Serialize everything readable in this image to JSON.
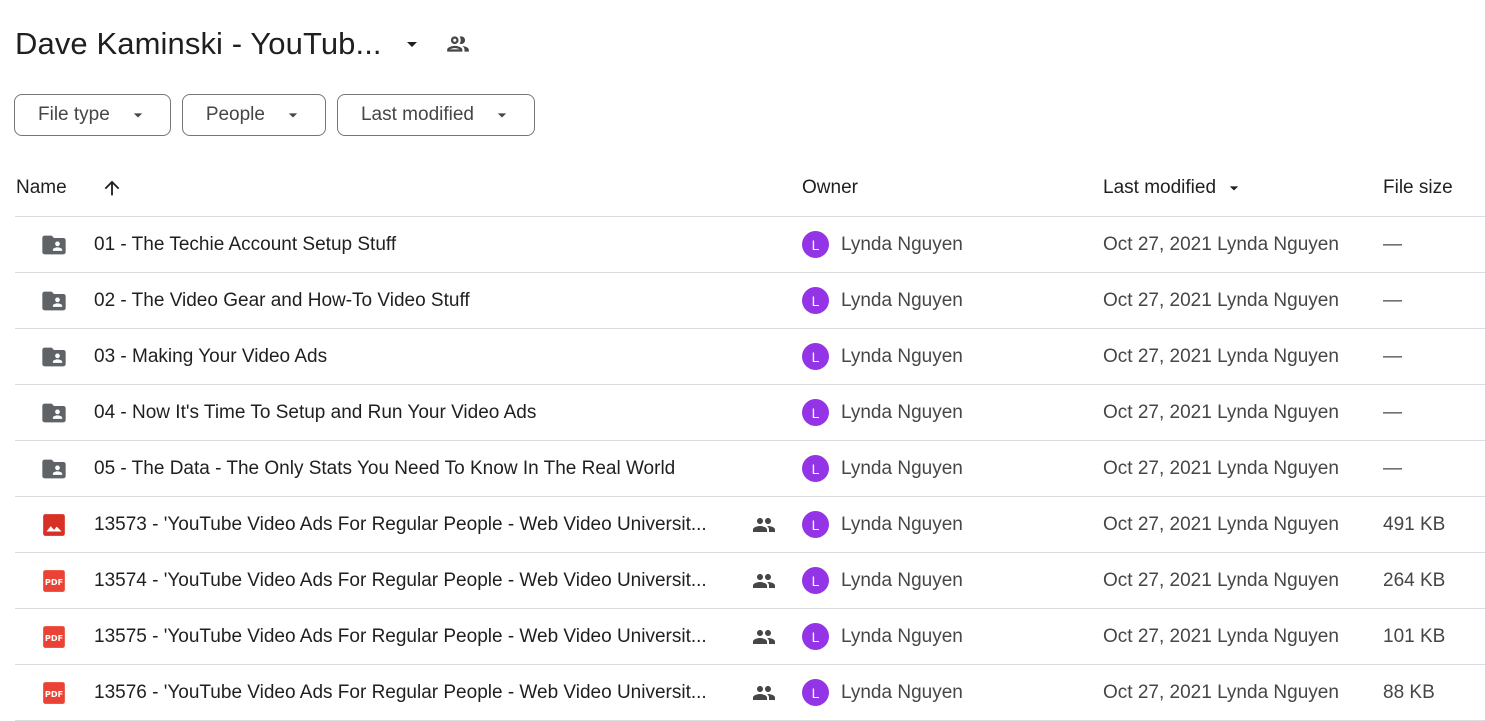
{
  "header": {
    "title": "Dave Kaminski - YouTub...",
    "caret_icon": "arrow-drop-down-icon",
    "shared_icon": "people-icon"
  },
  "filters": [
    {
      "label": "File type"
    },
    {
      "label": "People"
    },
    {
      "label": "Last modified"
    }
  ],
  "columns": {
    "name": "Name",
    "owner": "Owner",
    "last_modified": "Last modified",
    "file_size": "File size"
  },
  "colors": {
    "folder": "#5f6368",
    "image": "#d93025",
    "pdf": "#ea4335",
    "avatar": "#9334e6"
  },
  "rows": [
    {
      "type": "shared-folder",
      "name": "01 - The Techie Account Setup Stuff",
      "shared": false,
      "owner_initial": "L",
      "owner": "Lynda Nguyen",
      "modified": "Oct 27, 2021 Lynda Nguyen",
      "size": "—"
    },
    {
      "type": "shared-folder",
      "name": "02 - The Video Gear and How-To Video Stuff",
      "shared": false,
      "owner_initial": "L",
      "owner": "Lynda Nguyen",
      "modified": "Oct 27, 2021 Lynda Nguyen",
      "size": "—"
    },
    {
      "type": "shared-folder",
      "name": "03 - Making Your Video Ads",
      "shared": false,
      "owner_initial": "L",
      "owner": "Lynda Nguyen",
      "modified": "Oct 27, 2021 Lynda Nguyen",
      "size": "—"
    },
    {
      "type": "shared-folder",
      "name": "04 - Now It's Time To Setup and Run Your Video Ads",
      "shared": false,
      "owner_initial": "L",
      "owner": "Lynda Nguyen",
      "modified": "Oct 27, 2021 Lynda Nguyen",
      "size": "—"
    },
    {
      "type": "shared-folder",
      "name": "05 - The Data - The Only Stats You Need To Know In The Real World",
      "shared": false,
      "owner_initial": "L",
      "owner": "Lynda Nguyen",
      "modified": "Oct 27, 2021 Lynda Nguyen",
      "size": "—"
    },
    {
      "type": "image",
      "name": "13573 - 'YouTube Video Ads For Regular People - Web Video Universit...",
      "shared": true,
      "owner_initial": "L",
      "owner": "Lynda Nguyen",
      "modified": "Oct 27, 2021 Lynda Nguyen",
      "size": "491 KB"
    },
    {
      "type": "pdf",
      "name": "13574 - 'YouTube Video Ads For Regular People - Web Video Universit...",
      "shared": true,
      "owner_initial": "L",
      "owner": "Lynda Nguyen",
      "modified": "Oct 27, 2021 Lynda Nguyen",
      "size": "264 KB"
    },
    {
      "type": "pdf",
      "name": "13575 - 'YouTube Video Ads For Regular People - Web Video Universit...",
      "shared": true,
      "owner_initial": "L",
      "owner": "Lynda Nguyen",
      "modified": "Oct 27, 2021 Lynda Nguyen",
      "size": "101 KB"
    },
    {
      "type": "pdf",
      "name": "13576 - 'YouTube Video Ads For Regular People - Web Video Universit...",
      "shared": true,
      "owner_initial": "L",
      "owner": "Lynda Nguyen",
      "modified": "Oct 27, 2021 Lynda Nguyen",
      "size": "88 KB"
    }
  ]
}
